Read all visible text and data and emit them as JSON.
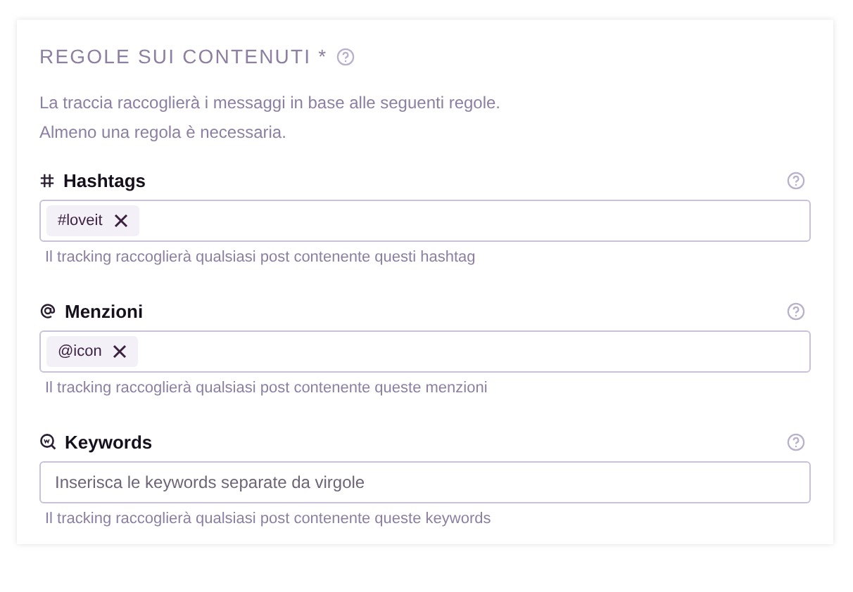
{
  "section": {
    "title": "REGOLE SUI CONTENUTI *",
    "description": [
      "La traccia raccoglierà i messaggi in base alle seguenti regole.",
      "Almeno una regola è necessaria."
    ]
  },
  "fields": [
    {
      "kind": "hashtag",
      "label": "Hashtags",
      "tags": [
        "#loveit"
      ],
      "hint": "Il tracking raccoglierà qualsiasi post contenente questi hashtag"
    },
    {
      "kind": "mention",
      "label": "Menzioni",
      "tags": [
        "@icon"
      ],
      "hint": "Il tracking raccoglierà qualsiasi post contenente queste menzioni"
    },
    {
      "kind": "keyword",
      "label": "Keywords",
      "placeholder": "Inserisca le keywords separate da virgole",
      "hint": "Il tracking raccoglierà qualsiasi post contenente queste keywords"
    }
  ]
}
